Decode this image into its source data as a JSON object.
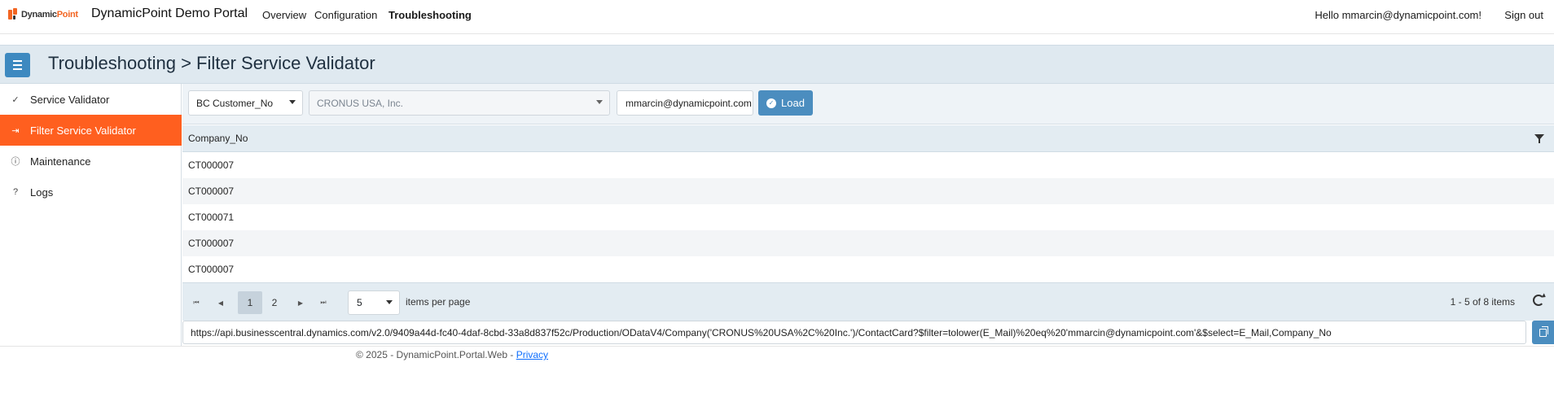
{
  "nav": {
    "logo_text_a": "Dynamic",
    "logo_text_b": "Point",
    "brand": "DynamicPoint Demo Portal",
    "links": [
      "Overview",
      "Configuration",
      "Troubleshooting"
    ],
    "active_link": "Troubleshooting",
    "hello": "Hello mmarcin@dynamicpoint.com!",
    "signout": "Sign out"
  },
  "header": {
    "title": "Troubleshooting > Filter Service Validator",
    "menu_icon": "hamburger-icon"
  },
  "sidebar": {
    "items": [
      {
        "label": "Service Validator",
        "icon": "check-icon",
        "glyph": "✓",
        "active": false
      },
      {
        "label": "Filter Service Validator",
        "icon": "filter-arrow-icon",
        "glyph": "⇥",
        "active": true
      },
      {
        "label": "Maintenance",
        "icon": "info-circle-icon",
        "glyph": "ⓘ",
        "active": false
      },
      {
        "label": "Logs",
        "icon": "help-circle-icon",
        "glyph": "?",
        "active": false
      }
    ]
  },
  "toolbar": {
    "service_select": "BC Customer_No",
    "company_select": "CRONUS USA, Inc.",
    "email_value": "mmarcin@dynamicpoint.com",
    "load_label": "Load"
  },
  "grid": {
    "column": "Company_No",
    "rows": [
      "CT000007",
      "CT000007",
      "CT000071",
      "CT000007",
      "CT000007"
    ]
  },
  "pager": {
    "pages": [
      "1",
      "2"
    ],
    "current_page": "1",
    "page_size": "5",
    "page_size_label": "items per page",
    "range": "1 - 5 of 8 items"
  },
  "url": "https://api.businesscentral.dynamics.com/v2.0/9409a44d-fc40-4daf-8cbd-33a8d837f52c/Production/ODataV4/Company('CRONUS%20USA%2C%20Inc.')/ContactCard?$filter=tolower(E_Mail)%20eq%20'mmarcin@dynamicpoint.com'&$select=E_Mail,Company_No",
  "footer": {
    "text": "© 2025 - DynamicPoint.Portal.Web - ",
    "privacy": "Privacy"
  },
  "colors": {
    "accent": "#ff5f1f",
    "primary": "#4b8dbf",
    "header_bg": "#dfe9f0"
  }
}
